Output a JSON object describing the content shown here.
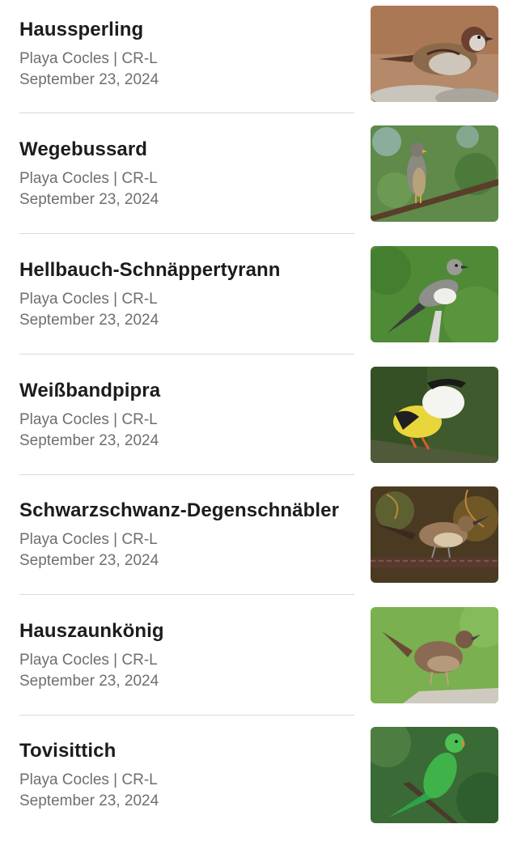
{
  "sightings": [
    {
      "name": "Haussperling",
      "location": "Playa Cocles | CR-L",
      "date": "September 23, 2024",
      "photo_icon": "house-sparrow-photo",
      "palette": {
        "bg": "#b08060",
        "body": "#8a6a4a",
        "accent": "#5a3a28"
      }
    },
    {
      "name": "Wegebussard",
      "location": "Playa Cocles | CR-L",
      "date": "September 23, 2024",
      "photo_icon": "roadside-hawk-photo",
      "palette": {
        "bg": "#5f8a4a",
        "body": "#8c8a80",
        "accent": "#6b4a30"
      }
    },
    {
      "name": "Hellbauch-Schnäppertyrann",
      "location": "Playa Cocles | CR-L",
      "date": "September 23, 2024",
      "photo_icon": "flycatcher-photo",
      "palette": {
        "bg": "#4f8a36",
        "body": "#9a9a96",
        "accent": "#3c3c3c"
      }
    },
    {
      "name": "Weißbandpipra",
      "location": "Playa Cocles | CR-L",
      "date": "September 23, 2024",
      "photo_icon": "manakin-photo",
      "palette": {
        "bg": "#3f5a2c",
        "body": "#e8d63a",
        "accent": "#1a1a1a"
      }
    },
    {
      "name": "Schwarzschwanz-Degenschnäbler",
      "location": "Playa Cocles | CR-L",
      "date": "September 23, 2024",
      "photo_icon": "thrush-photo",
      "palette": {
        "bg": "#4a3a22",
        "body": "#9a7a5a",
        "accent": "#5a4030"
      }
    },
    {
      "name": "Hauszaunkönig",
      "location": "Playa Cocles | CR-L",
      "date": "September 23, 2024",
      "photo_icon": "house-wren-photo",
      "palette": {
        "bg": "#7ab050",
        "body": "#8a6a52",
        "accent": "#5a4232"
      }
    },
    {
      "name": "Tovisittich",
      "location": "Playa Cocles | CR-L",
      "date": "September 23, 2024",
      "photo_icon": "parakeet-photo",
      "palette": {
        "bg": "#3a6a36",
        "body": "#3fb24a",
        "accent": "#d88a3a"
      }
    }
  ]
}
